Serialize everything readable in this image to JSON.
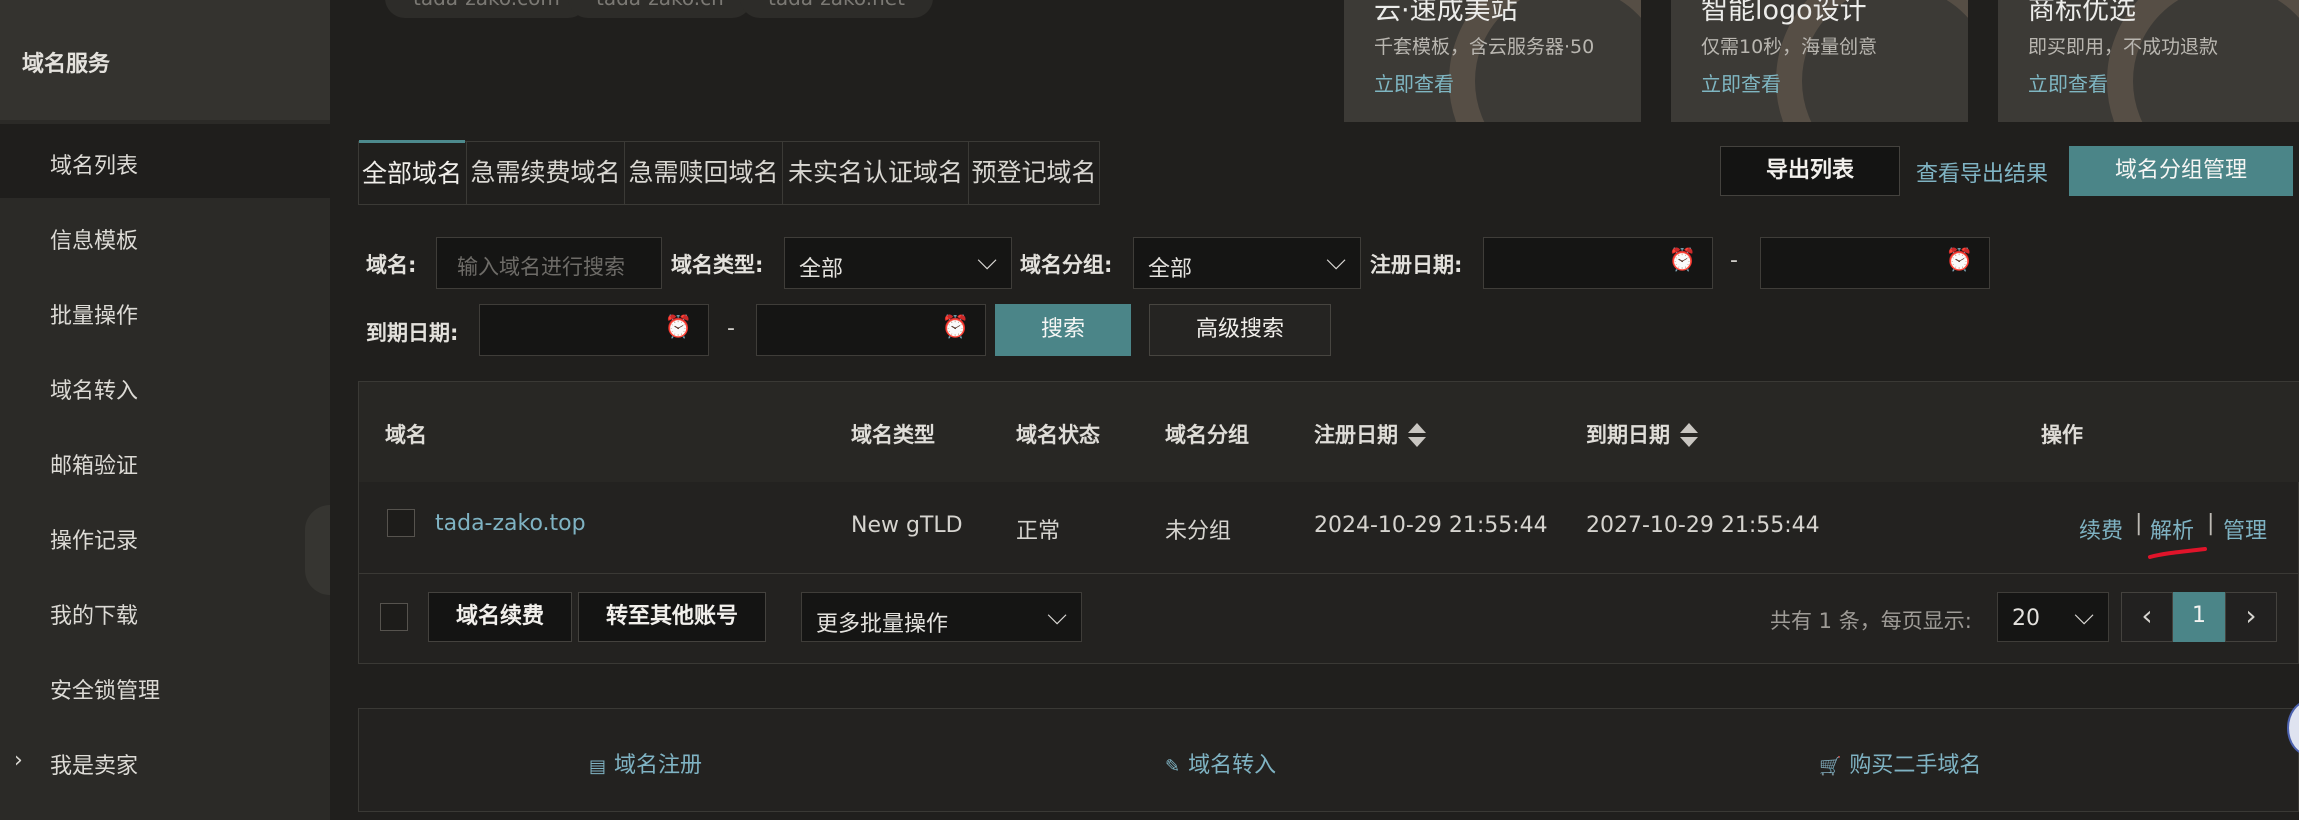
{
  "sidebar": {
    "title": "域名服务",
    "items": [
      {
        "label": "域名列表",
        "active": true
      },
      {
        "label": "信息模板"
      },
      {
        "label": "批量操作"
      },
      {
        "label": "域名转入"
      },
      {
        "label": "邮箱验证"
      },
      {
        "label": "操作记录"
      },
      {
        "label": "我的下载"
      },
      {
        "label": "安全锁管理"
      },
      {
        "label": "我是卖家",
        "expandable": true
      }
    ]
  },
  "top_tags": [
    "tada-zako.com",
    "tada-zako.cn",
    "tada-zako.net"
  ],
  "banners": [
    {
      "title": "云·速成美站",
      "subtitle": "千套模板，含云服务器·50",
      "link": "立即查看"
    },
    {
      "title": "智能logo设计",
      "subtitle": "仅需10秒，海量创意",
      "link": "立即查看"
    },
    {
      "title": "商标优选",
      "subtitle": "即买即用，不成功退款",
      "link": "立即查看"
    }
  ],
  "tabs": [
    {
      "label": "全部域名",
      "active": true
    },
    {
      "label": "急需续费域名"
    },
    {
      "label": "急需赎回域名"
    },
    {
      "label": "未实名认证域名"
    },
    {
      "label": "预登记域名"
    }
  ],
  "toolbar": {
    "export_label": "导出列表",
    "view_export_label": "查看导出结果",
    "group_manage_label": "域名分组管理"
  },
  "filters": {
    "domain_label": "域名:",
    "domain_placeholder": "输入域名进行搜索",
    "type_label": "域名类型:",
    "type_value": "全部",
    "group_label": "域名分组:",
    "group_value": "全部",
    "reg_date_label": "注册日期:",
    "exp_date_label": "到期日期:",
    "range_sep": "-",
    "search_label": "搜索",
    "advanced_label": "高级搜索"
  },
  "table": {
    "headers": {
      "domain": "域名",
      "type": "域名类型",
      "status": "域名状态",
      "group": "域名分组",
      "reg_date": "注册日期",
      "exp_date": "到期日期",
      "actions": "操作"
    },
    "rows": [
      {
        "domain": "tada-zako.top",
        "type": "New gTLD",
        "status": "正常",
        "group": "未分组",
        "reg_date": "2024-10-29 21:55:44",
        "exp_date": "2027-10-29 21:55:44",
        "actions": [
          "续费",
          "解析",
          "管理"
        ]
      }
    ],
    "action_sep": "|"
  },
  "bulk": {
    "renew_label": "域名续费",
    "transfer_label": "转至其他账号",
    "more_label": "更多批量操作"
  },
  "pagination": {
    "summary": "共有 1 条，每页显示:",
    "page_size": "20",
    "prev": "‹",
    "current_page": "1",
    "next": "›"
  },
  "footer_links": [
    {
      "label": "域名注册",
      "icon": "document-icon"
    },
    {
      "label": "域名转入",
      "icon": "pencil-icon"
    },
    {
      "label": "购买二手域名",
      "icon": "cart-icon"
    }
  ],
  "colors": {
    "accent_teal": "#4b8588",
    "link_blue": "#7fb3c3",
    "annotation_red": "#e0142a"
  }
}
